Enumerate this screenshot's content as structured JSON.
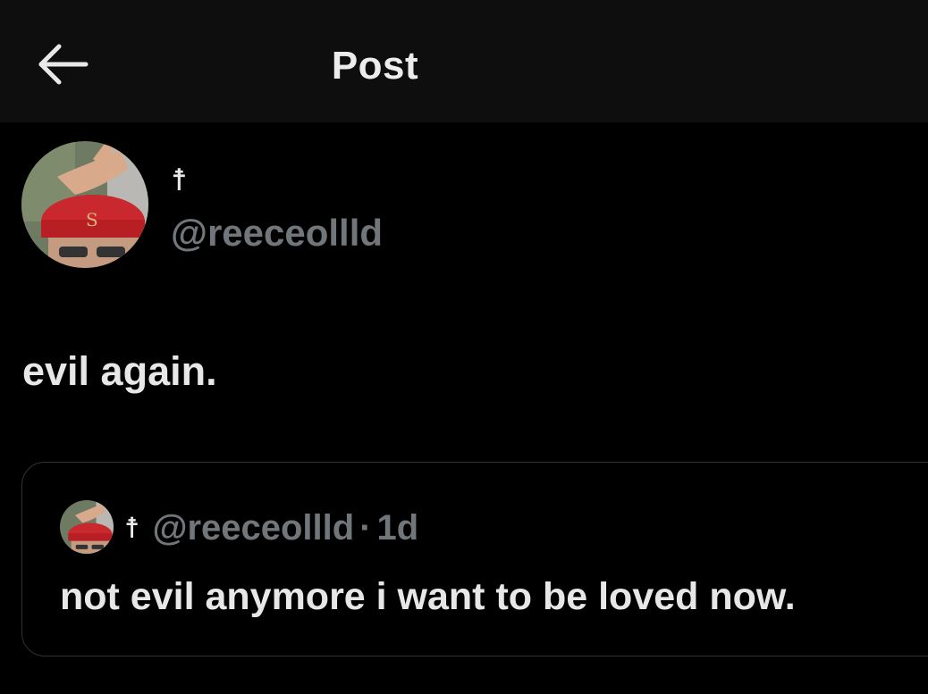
{
  "header": {
    "title": "Post",
    "back_icon": "arrow-left-icon"
  },
  "post": {
    "author": {
      "display_name": "☨",
      "handle": "@reeceollld"
    },
    "text": "evil again."
  },
  "quoted_post": {
    "author": {
      "display_name": "☨",
      "handle": "@reeceollld"
    },
    "separator": "·",
    "time": "1d",
    "text": "not evil anymore i want to be loved now."
  },
  "colors": {
    "background": "#000000",
    "header_background": "#0e0e0e",
    "primary_text": "#e7e7e7",
    "secondary_text": "#71767b",
    "border": "#2f3336",
    "cap_red": "#c8282e"
  }
}
